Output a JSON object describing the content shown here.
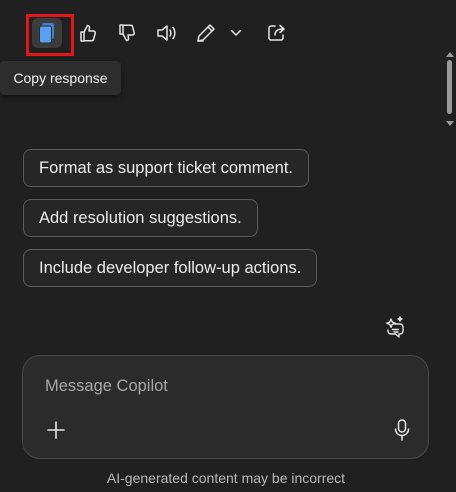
{
  "toolbar": {
    "icons": [
      "copy-icon",
      "thumbs-up-icon",
      "thumbs-down-icon",
      "speaker-icon",
      "pen-icon",
      "chevron-down-icon",
      "share-icon"
    ],
    "tooltip": "Copy response"
  },
  "colors": {
    "background": "#202020",
    "copy_icon": "#5aa0f0",
    "highlight": "#e0161b"
  },
  "suggestions": [
    "Format as support ticket comment.",
    "Add resolution suggestions.",
    "Include developer follow-up actions."
  ],
  "composer": {
    "placeholder": "Message Copilot",
    "value": ""
  },
  "disclaimer": "AI-generated content may be incorrect"
}
